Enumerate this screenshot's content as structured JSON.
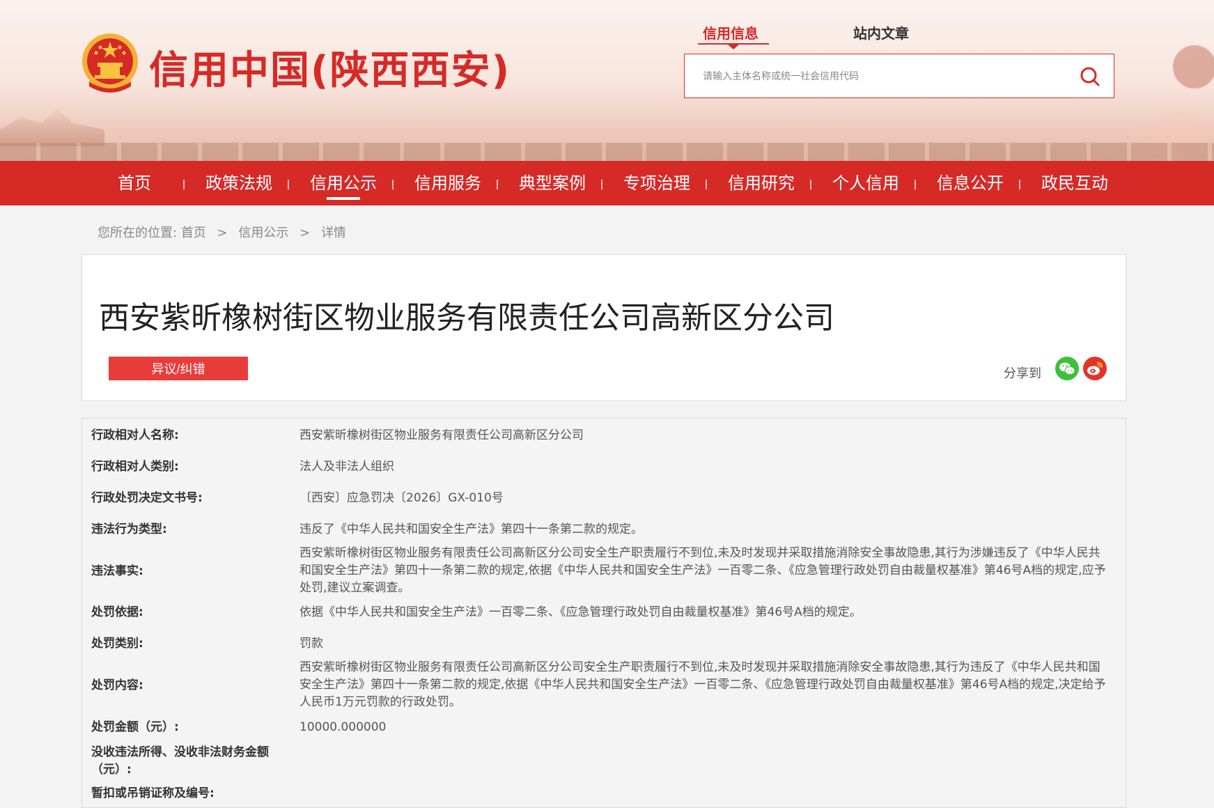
{
  "header": {
    "site_title": "信用中国(陕西西安)",
    "search_tabs": [
      "信用信息",
      "站内文章"
    ],
    "search_placeholder": "请输入主体名称或统一社会信用代码"
  },
  "nav": {
    "items": [
      "首页",
      "政策法规",
      "信用公示",
      "信用服务",
      "典型案例",
      "专项治理",
      "信用研究",
      "个人信用",
      "信息公开",
      "政民互动"
    ],
    "active_index": 2
  },
  "breadcrumb": {
    "prefix": "您所在的位置:",
    "items": [
      "首页",
      "信用公示",
      "详情"
    ],
    "separator": ">"
  },
  "entity": {
    "title": "西安紫昕橡树街区物业服务有限责任公司高新区分公司",
    "dispute_label": "异议/纠错",
    "share_label": "分享到"
  },
  "details": [
    {
      "label": "行政相对人名称:",
      "value": "西安紫昕橡树街区物业服务有限责任公司高新区分公司"
    },
    {
      "label": "行政相对人类别:",
      "value": "法人及非法人组织"
    },
    {
      "label": "行政处罚决定文书号:",
      "value": "〔西安〕应急罚决〔2026〕GX-010号"
    },
    {
      "label": "违法行为类型:",
      "value": "违反了《中华人民共和国安全生产法》第四十一条第二款的规定。"
    },
    {
      "label": "违法事实:",
      "value": "西安紫昕橡树街区物业服务有限责任公司高新区分公司安全生产职责履行不到位,未及时发现并采取措施消除安全事故隐患,其行为涉嫌违反了《中华人民共和国安全生产法》第四十一条第二款的规定,依据《中华人民共和国安全生产法》一百零二条、《应急管理行政处罚自由裁量权基准》第46号A档的规定,应予处罚,建议立案调查。"
    },
    {
      "label": "处罚依据:",
      "value": "依据《中华人民共和国安全生产法》一百零二条、《应急管理行政处罚自由裁量权基准》第46号A档的规定。"
    },
    {
      "label": "处罚类别:",
      "value": "罚款"
    },
    {
      "label": "处罚内容:",
      "value": "西安紫昕橡树街区物业服务有限责任公司高新区分公司安全生产职责履行不到位,未及时发现并采取措施消除安全事故隐患,其行为违反了《中华人民共和国安全生产法》第四十一条第二款的规定,依据《中华人民共和国安全生产法》一百零二条、《应急管理行政处罚自由裁量权基准》第46号A档的规定,决定给予人民币1万元罚款的行政处罚。"
    },
    {
      "label": "处罚金额（元）:",
      "value": "10000.000000"
    },
    {
      "label": "没收违法所得、没收非法财务金额（元）:",
      "value": ""
    },
    {
      "label": "暂扣或吊销证称及编号:",
      "value": ""
    }
  ],
  "colors": {
    "brand_red": "#d62a27",
    "button_red": "#e83c3a",
    "wechat_green": "#3ec13a",
    "weibo_red": "#e3342c"
  },
  "icons": {
    "emblem": "national-emblem-icon",
    "search": "search-icon",
    "wechat": "wechat-icon",
    "weibo": "weibo-icon"
  }
}
